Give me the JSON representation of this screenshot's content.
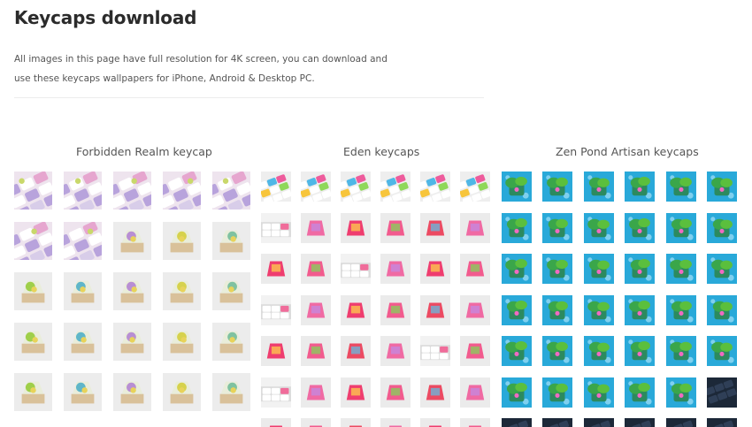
{
  "page": {
    "title": "Keycaps download",
    "description": "All images in this page have full resolution for 4K screen, you can download and use these keycaps wallpapers for iPhone, Android & Desktop PC."
  },
  "colors": {
    "pink_purple_bg": "#ead9ea",
    "resin_bg": "#e4e4e4",
    "teal_water": "#29a9d9",
    "dark_keyboard": "#1c2838"
  },
  "sections": [
    {
      "id": "forbidden",
      "title": "Forbidden Realm keycap",
      "images": [
        "purple-keyboard",
        "purple-keyboard",
        "purple-keyboard",
        "purple-keyboard",
        "purple-keyboard",
        "purple-keyboard",
        "purple-keyboard",
        "wood-resin",
        "wood-resin",
        "wood-resin",
        "wood-resin",
        "wood-resin",
        "wood-resin",
        "wood-resin",
        "wood-resin",
        "wood-resin",
        "wood-resin",
        "wood-resin",
        "wood-resin",
        "wood-resin",
        "wood-resin",
        "wood-resin",
        "wood-resin",
        "wood-resin",
        "wood-resin"
      ]
    },
    {
      "id": "eden",
      "title": "Eden keycaps",
      "images": [
        "rainbow-keyboard",
        "rainbow-keyboard",
        "rainbow-keyboard",
        "rainbow-keyboard",
        "rainbow-keyboard",
        "rainbow-keyboard",
        "white-keyboard-pink",
        "pink-resin",
        "pink-resin",
        "pink-resin",
        "pink-resin",
        "pink-resin",
        "pink-resin",
        "pink-resin",
        "white-keyboard-pink",
        "pink-resin",
        "pink-resin",
        "pink-resin",
        "white-keyboard-pink",
        "pink-resin",
        "pink-resin",
        "pink-resin",
        "pink-resin",
        "pink-resin",
        "pink-resin",
        "pink-resin",
        "pink-resin",
        "pink-resin",
        "white-keyboard-pink",
        "pink-resin",
        "white-keyboard-pink",
        "pink-resin",
        "pink-resin",
        "pink-resin",
        "pink-resin",
        "pink-resin",
        "pink-resin",
        "pink-resin",
        "pink-resin",
        "pink-resin",
        "pink-resin",
        "pink-resin"
      ]
    },
    {
      "id": "zen",
      "title": "Zen Pond Artisan keycaps",
      "images": [
        "pond-keycap",
        "pond-keycap",
        "pond-keycap",
        "pond-keycap",
        "pond-keycap",
        "pond-keycap",
        "pond-keycap",
        "pond-keycap",
        "pond-keycap",
        "pond-keycap",
        "pond-keycap",
        "pond-keycap",
        "pond-keycap",
        "pond-keycap",
        "pond-keycap",
        "pond-keycap",
        "pond-keycap",
        "pond-keycap",
        "pond-keycap",
        "pond-keycap",
        "pond-keycap",
        "pond-keycap",
        "pond-keycap",
        "pond-keycap",
        "pond-keycap",
        "pond-keycap",
        "pond-keycap",
        "pond-keycap",
        "pond-keycap",
        "pond-keycap",
        "pond-keycap",
        "pond-keycap",
        "pond-keycap",
        "pond-keycap",
        "pond-keycap",
        "dark-keyboard",
        "dark-keyboard",
        "dark-keyboard",
        "dark-keyboard",
        "dark-keyboard",
        "dark-keyboard",
        "dark-keyboard"
      ]
    }
  ]
}
